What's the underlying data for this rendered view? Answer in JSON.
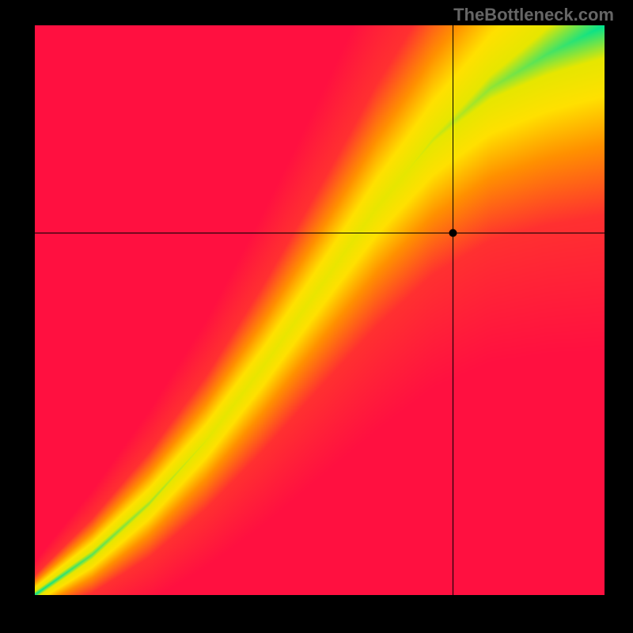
{
  "watermark": "TheBottleneck.com",
  "chart_data": {
    "type": "heatmap",
    "title": "",
    "xlabel": "",
    "ylabel": "",
    "xlim": [
      0,
      1
    ],
    "ylim": [
      0,
      1
    ],
    "marker": {
      "x": 0.735,
      "y": 0.635
    },
    "crosshair": {
      "x": 0.735,
      "y": 0.635
    },
    "ridge": {
      "description": "green optimal-balance diagonal curve from bottom-left to top-right",
      "points": [
        {
          "x": 0.0,
          "y": 0.0
        },
        {
          "x": 0.1,
          "y": 0.07
        },
        {
          "x": 0.2,
          "y": 0.16
        },
        {
          "x": 0.3,
          "y": 0.27
        },
        {
          "x": 0.4,
          "y": 0.4
        },
        {
          "x": 0.5,
          "y": 0.54
        },
        {
          "x": 0.6,
          "y": 0.68
        },
        {
          "x": 0.7,
          "y": 0.8
        },
        {
          "x": 0.8,
          "y": 0.89
        },
        {
          "x": 0.9,
          "y": 0.95
        },
        {
          "x": 1.0,
          "y": 1.0
        }
      ],
      "width_fraction_at": [
        {
          "x": 0.0,
          "w": 0.01
        },
        {
          "x": 0.3,
          "w": 0.04
        },
        {
          "x": 0.6,
          "w": 0.075
        },
        {
          "x": 1.0,
          "w": 0.11
        }
      ]
    },
    "palette": {
      "stops": [
        {
          "d": 0.0,
          "color": "#00e28e"
        },
        {
          "d": 0.6,
          "color": "#e6e600"
        },
        {
          "d": 1.3,
          "color": "#ffe000"
        },
        {
          "d": 2.2,
          "color": "#ff9000"
        },
        {
          "d": 3.5,
          "color": "#ff3030"
        },
        {
          "d": 6.0,
          "color": "#ff1040"
        }
      ]
    }
  }
}
